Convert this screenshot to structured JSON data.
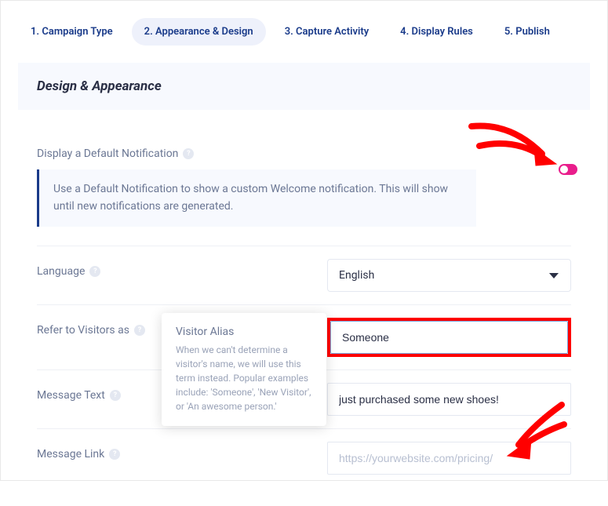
{
  "steps": {
    "s1": "1. Campaign Type",
    "s2": "2. Appearance & Design",
    "s3": "3. Capture Activity",
    "s4": "4. Display Rules",
    "s5": "5. Publish"
  },
  "panel": {
    "title": "Design & Appearance"
  },
  "notification": {
    "label": "Display a Default Notification",
    "hint": "Use a Default Notification to show a custom Welcome notification. This will show until new notifications are generated."
  },
  "language": {
    "label": "Language",
    "value": "English"
  },
  "visitor": {
    "label": "Refer to Visitors as",
    "value": "Someone"
  },
  "tooltip": {
    "title": "Visitor Alias",
    "text": "When we can't determine a visitor's name, we will use this term instead. Popular examples include: 'Someone', 'New Visitor', or 'An awesome person.'"
  },
  "message": {
    "label": "Message Text",
    "value": "just purchased some new shoes!"
  },
  "link": {
    "label": "Message Link",
    "placeholder": "https://yourwebsite.com/pricing/"
  }
}
